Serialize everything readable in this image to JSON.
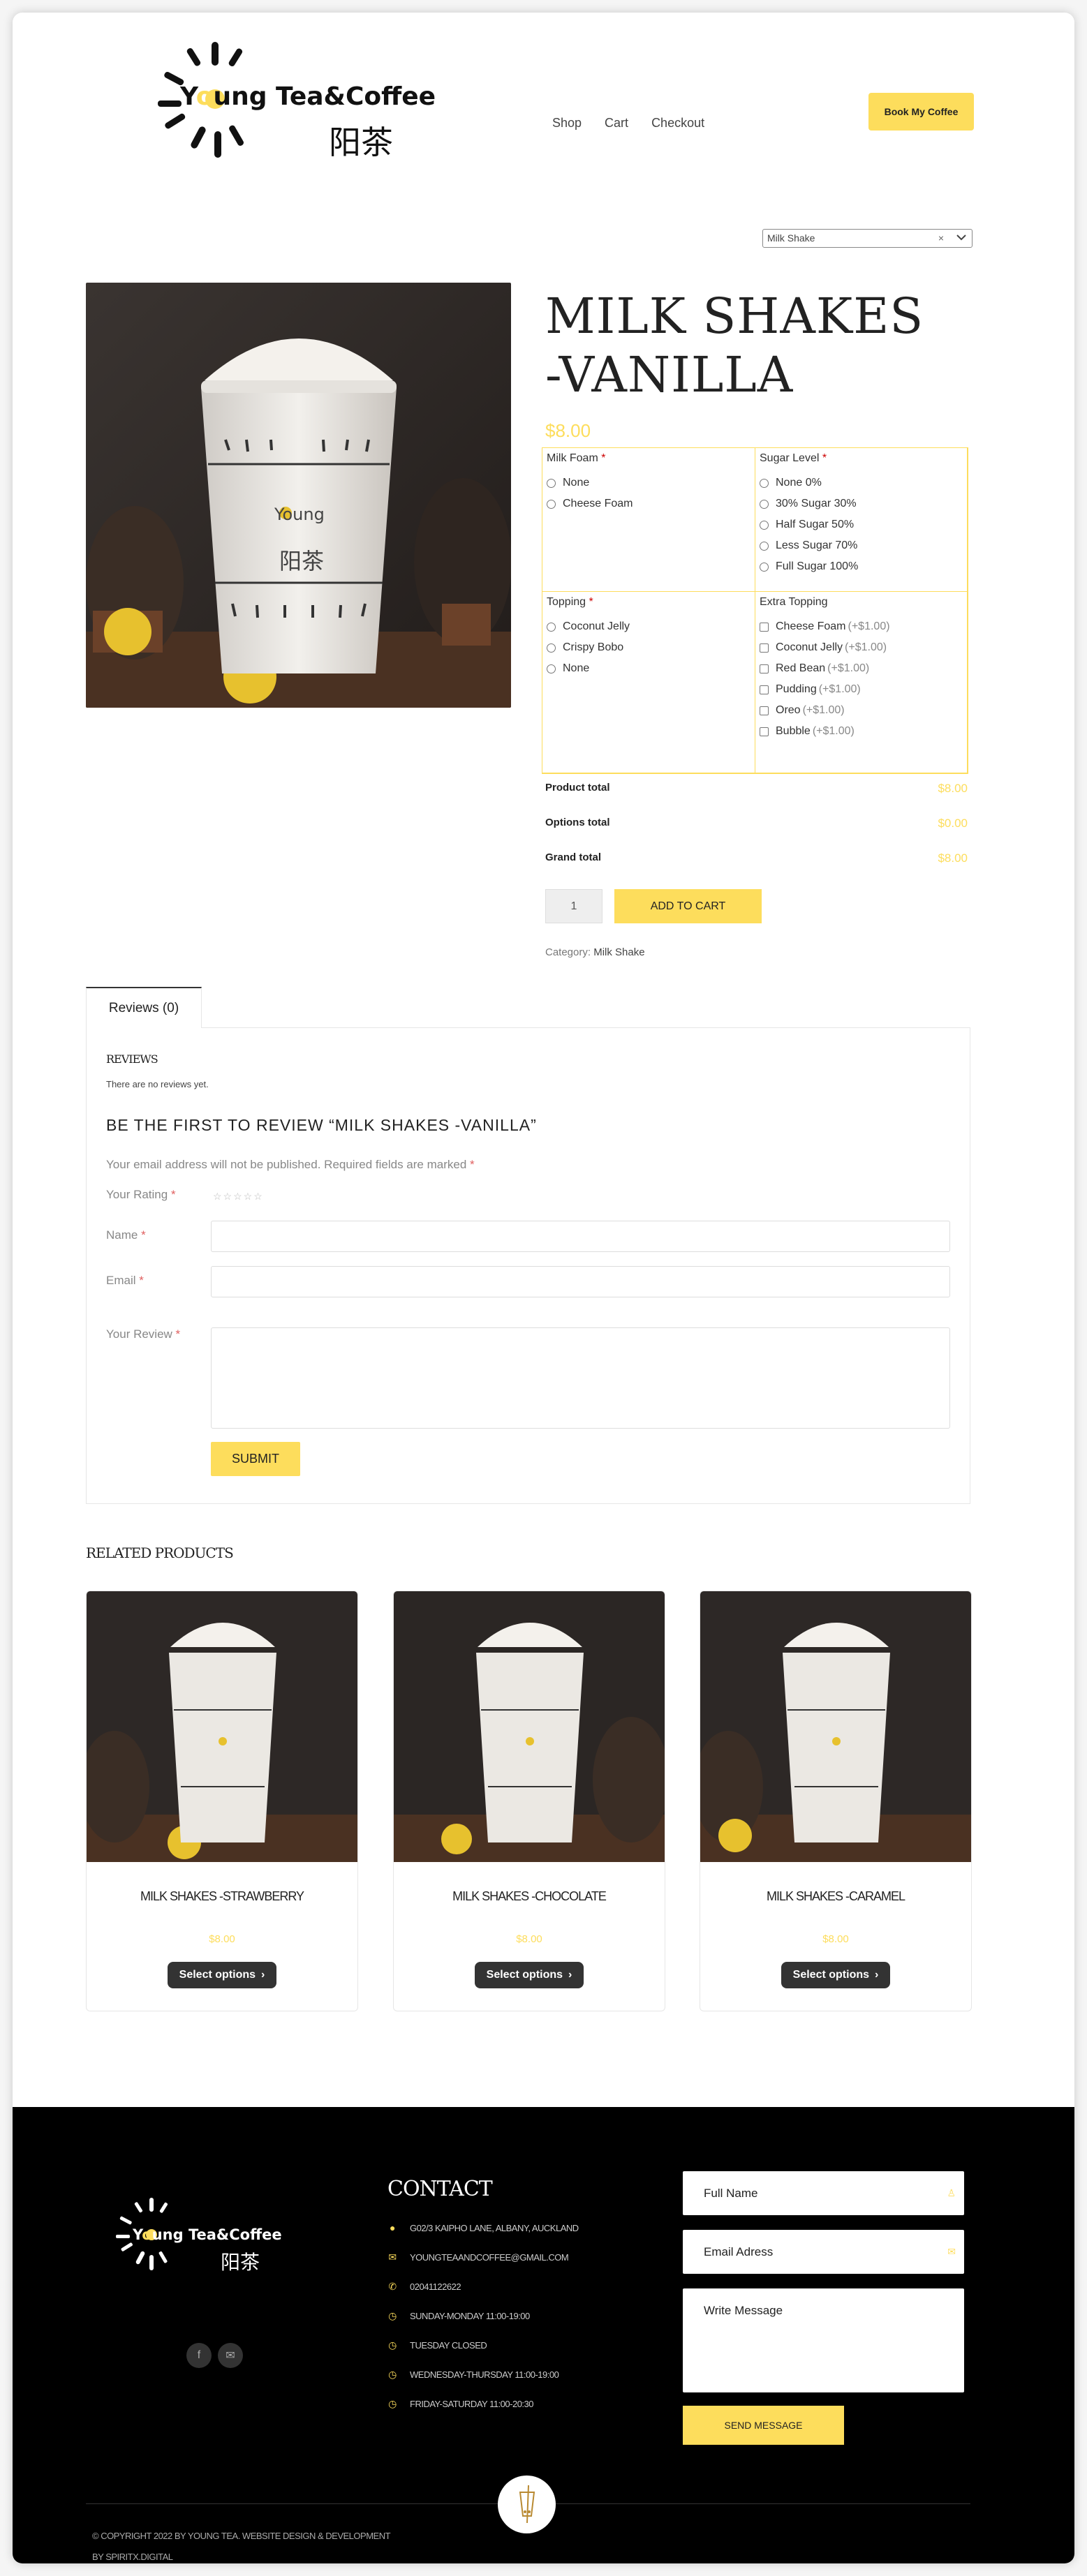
{
  "brand": {
    "name": "Young Tea&Coffee",
    "chinese": "阳茶"
  },
  "nav": {
    "items": [
      "Shop",
      "Cart",
      "Checkout"
    ],
    "book_label": "Book My Coffee"
  },
  "category_select": {
    "value": "Milk Shake",
    "clear": "×"
  },
  "product": {
    "title": "MILK SHAKES -VANILLA",
    "price": "$8.00",
    "cup_text": "Young",
    "cup_chinese": "阳茶"
  },
  "options": {
    "milk_foam": {
      "label": "Milk Foam",
      "required": "*",
      "choices": [
        "None",
        "Cheese Foam"
      ]
    },
    "sugar_level": {
      "label": "Sugar Level",
      "required": "*",
      "choices": [
        "None 0%",
        "30% Sugar 30%",
        "Half Sugar 50%",
        "Less Sugar 70%",
        "Full Sugar 100%"
      ]
    },
    "topping": {
      "label": "Topping",
      "required": "*",
      "choices": [
        "Coconut Jelly",
        "Crispy Bobo",
        "None"
      ]
    },
    "extra_topping": {
      "label": "Extra Topping",
      "choices": [
        {
          "name": "Cheese Foam",
          "extra": "(+$1.00)"
        },
        {
          "name": "Coconut Jelly",
          "extra": "(+$1.00)"
        },
        {
          "name": "Red Bean",
          "extra": "(+$1.00)"
        },
        {
          "name": "Pudding",
          "extra": "(+$1.00)"
        },
        {
          "name": "Oreo",
          "extra": "(+$1.00)"
        },
        {
          "name": "Bubble",
          "extra": "(+$1.00)"
        }
      ]
    }
  },
  "totals": {
    "product_total_label": "Product total",
    "product_total": "$8.00",
    "options_total_label": "Options total",
    "options_total": "$0.00",
    "grand_total_label": "Grand total",
    "grand_total": "$8.00"
  },
  "cart": {
    "quantity": "1",
    "add_label": "ADD TO CART"
  },
  "category": {
    "label": "Category:",
    "value": "Milk Shake"
  },
  "reviews": {
    "tab_label": "Reviews (0)",
    "title": "REVIEWS",
    "none_text": "There are no reviews yet.",
    "first_review": "BE THE FIRST TO REVIEW “MILK SHAKES -VANILLA”",
    "note": "Your email address will not be published. Required fields are marked",
    "star": "*",
    "rating_label": "Your Rating",
    "stars": "☆☆☆☆☆",
    "name_label": "Name",
    "email_label": "Email",
    "review_label": "Your Review",
    "submit_label": "SUBMIT"
  },
  "related": {
    "title": "RELATED PRODUCTS",
    "items": [
      {
        "name": "MILK SHAKES -STRAWBERRY",
        "price": "$8.00",
        "button": "Select options"
      },
      {
        "name": "MILK SHAKES -CHOCOLATE",
        "price": "$8.00",
        "button": "Select options"
      },
      {
        "name": "MILK SHAKES -CARAMEL",
        "price": "$8.00",
        "button": "Select options"
      }
    ]
  },
  "footer": {
    "contact_title": "CONTACT",
    "address": "G02/3 KAIPHO LANE, ALBANY, AUCKLAND",
    "email": "YOUNGTEAANDCOFFEE@GMAIL.COM",
    "phone": "02041122622",
    "hours_1": "SUNDAY-MONDAY 11:00-19:00",
    "hours_2": "TUESDAY CLOSED",
    "hours_3": "WEDNESDAY-THURSDAY 11:00-19:00",
    "hours_4": "FRIDAY-SATURDAY 11:00-20:30",
    "form_name": "Full Name",
    "form_email": "Email Adress",
    "form_message": "Write Message",
    "send_label": "SEND MESSAGE",
    "copyright": "© COPYRIGHT 2022 BY YOUNG TEA. WEBSITE DESIGN & DEVELOPMENT BY SPIRITX.DIGITAL"
  },
  "colors": {
    "accent": "#fddd5c",
    "dark": "#333333",
    "footer_bg": "#000000"
  }
}
